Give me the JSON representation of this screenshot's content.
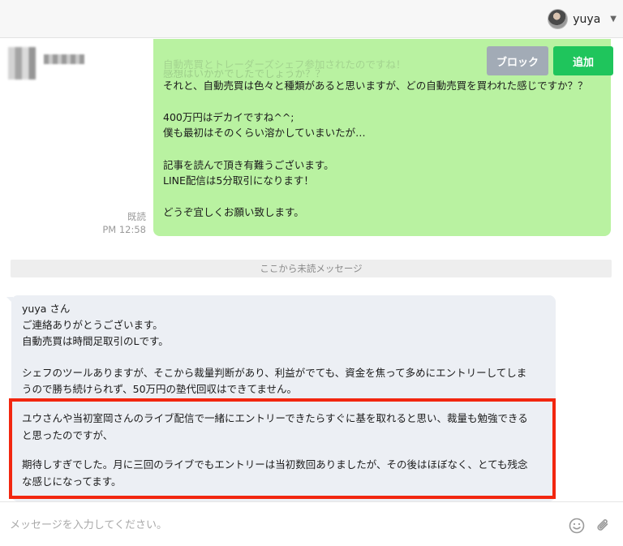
{
  "topbar": {
    "username": "yuya"
  },
  "chat_header": {
    "block_label": "ブロック",
    "add_label": "追加"
  },
  "outgoing": {
    "faded_line_1": "自動売買とトレーダーズシェフ参加されたのですね！",
    "faded_line_2": "感想はいかがでしたでしょうか？？",
    "lines": [
      "それと、自動売買は色々と種類があると思いますが、どの自動売買を買われた感じですか？？",
      "",
      "400万円はデカイですね^^;",
      "僕も最初はそのくらい溶かしていまいたが…",
      "",
      "記事を読んで頂き有難うございます。",
      "LINE配信は5分取引になります！",
      "",
      "どうぞ宜しくお願い致します。"
    ],
    "read_status": "既読",
    "time": "PM 12:58"
  },
  "divider": {
    "label": "ここから未読メッセージ"
  },
  "incoming": {
    "lines": [
      "yuya さん",
      "ご連絡ありがとうございます。",
      "自動売買は時間足取引のLです。",
      "",
      "シェフのツールありますが、そこから裁量判断があり、利益がでても、資金を焦って多めにエントリーしてしま",
      "うので勝ち続けられず、50万円の塾代回収はできてません。"
    ],
    "highlighted_lines": [
      "ユウさんや当初室岡さんのライブ配信で一緒にエントリーできたらすぐに基を取れると思い、裁量も勉強できる",
      "と思ったのですが、",
      "",
      "期待しすぎでした。月に三回のライブでもエントリーは当初数回ありましたが、その後はほぼなく、とても残念",
      "な感じになってます。"
    ],
    "highlight_color": "#f2260f"
  },
  "composer": {
    "placeholder": "メッセージを入力してください。"
  },
  "colors": {
    "outgoing_bubble": "#b9f2a1",
    "incoming_bubble": "#eceff4",
    "add_button": "#1fc55c",
    "block_button": "#a2abb6"
  }
}
